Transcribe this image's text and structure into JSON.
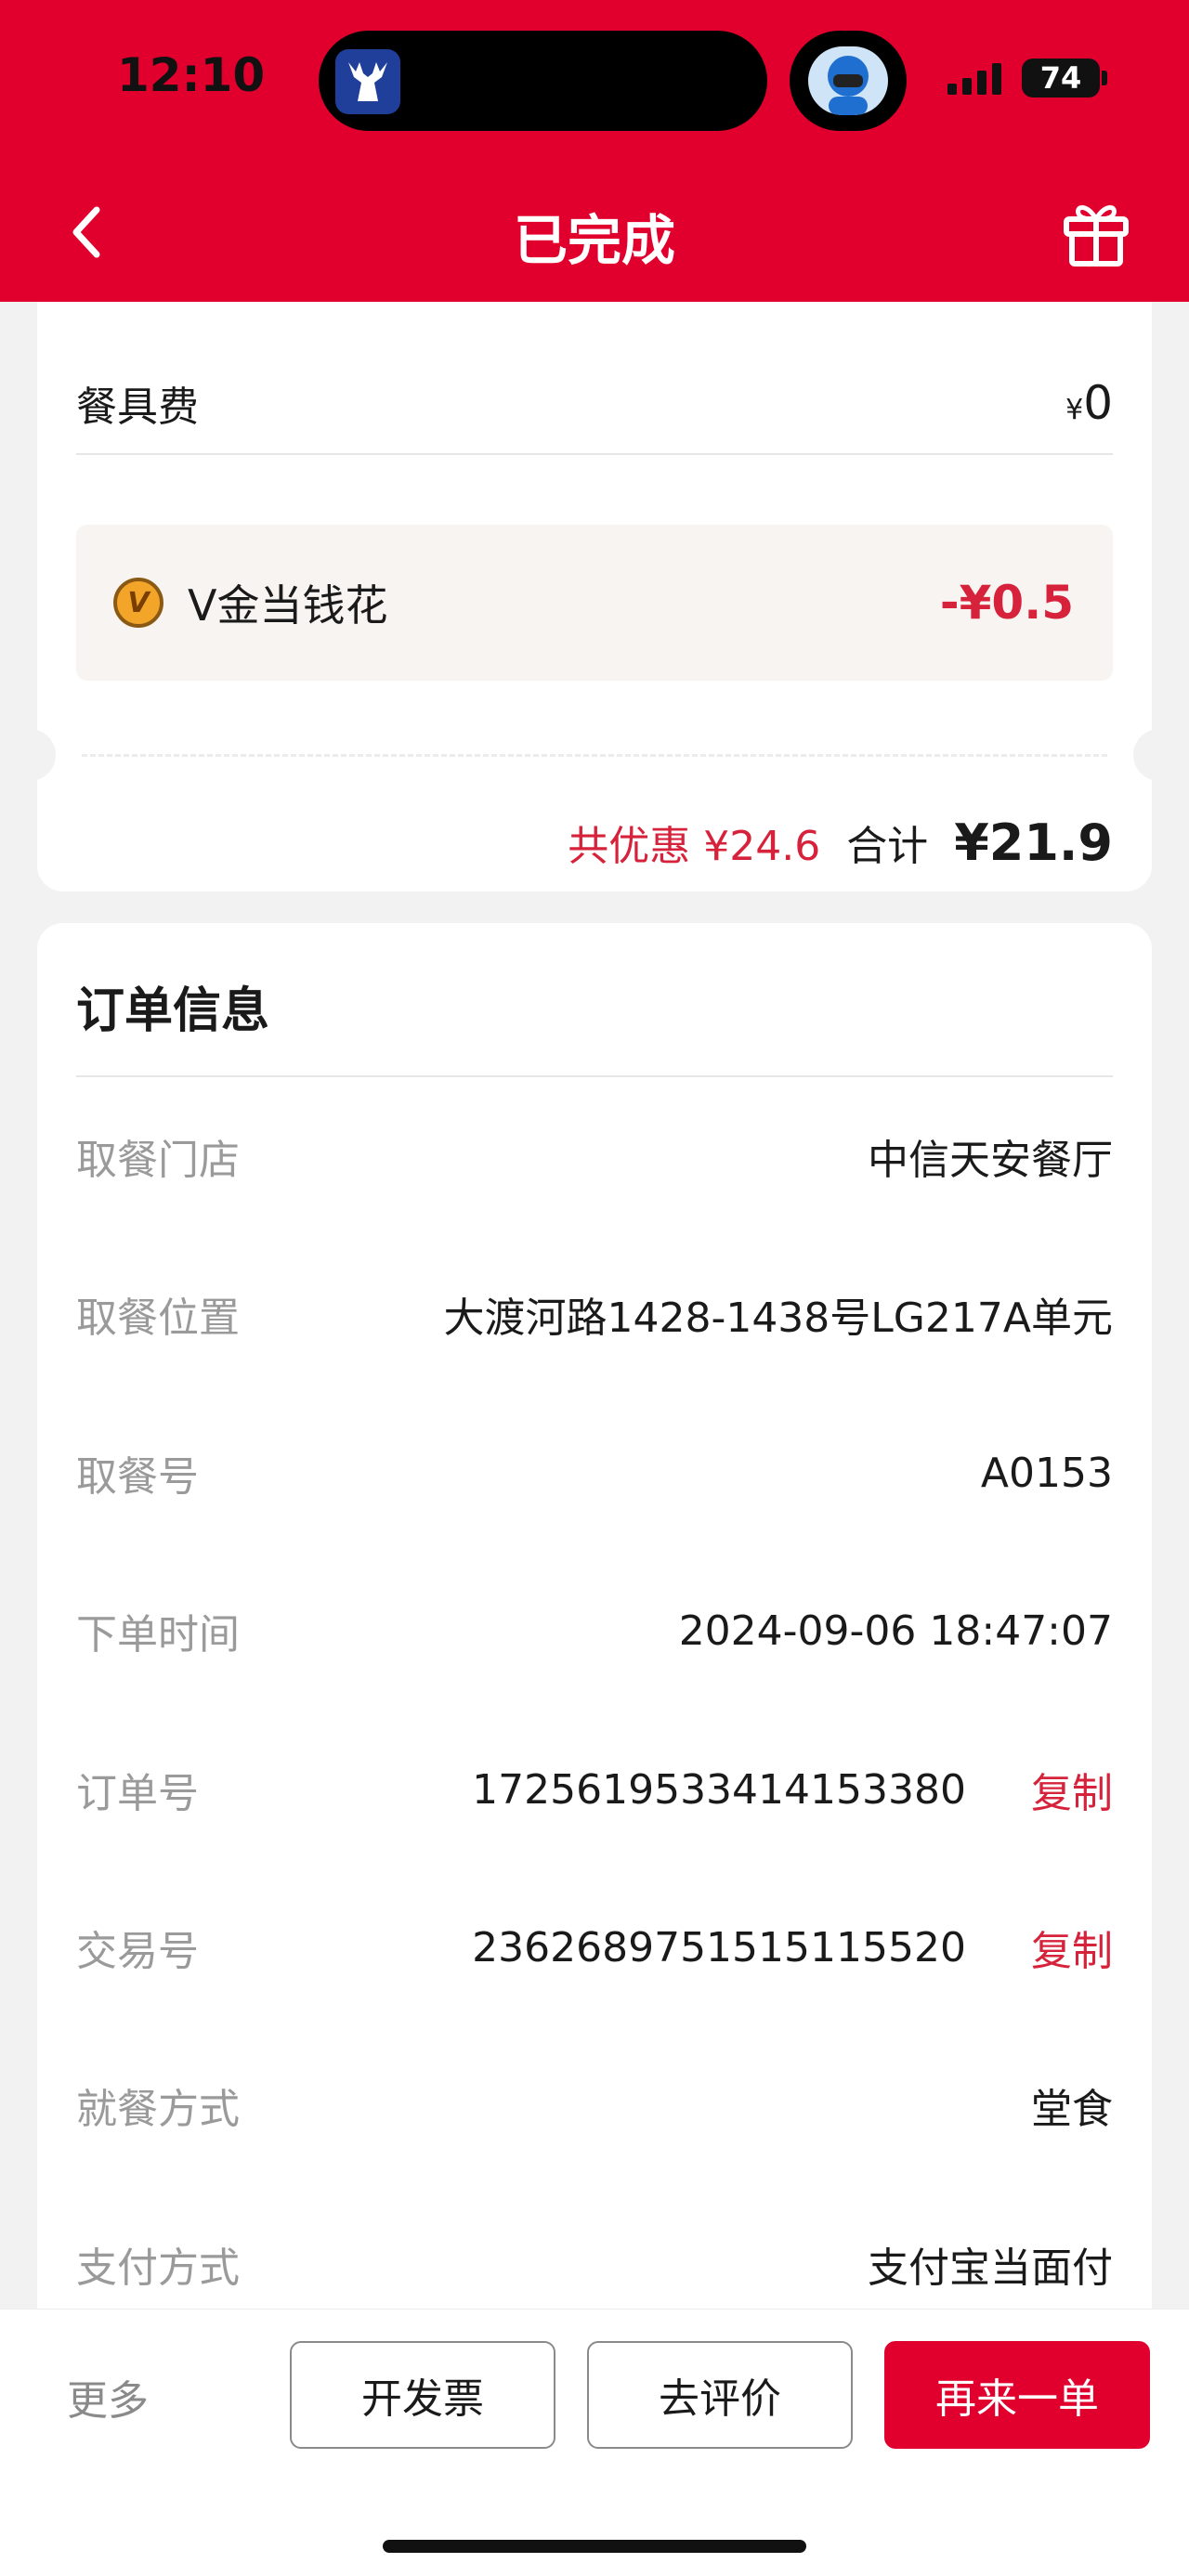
{
  "status_bar": {
    "time": "12:10",
    "battery": "74",
    "icons": [
      "signal-icon",
      "battery-icon"
    ]
  },
  "nav": {
    "title": "已完成",
    "back_icon": "chevron-left-icon",
    "gift_icon": "gift-icon"
  },
  "summary": {
    "tableware_label": "餐具费",
    "tableware_currency": "¥",
    "tableware_value": "0",
    "vgold_icon_text": "V",
    "vgold_label": "V金当钱花",
    "vgold_amount": "-¥0.5",
    "discount_text": "共优惠 ¥24.6",
    "total_label": "合计",
    "total_amount": "¥21.9"
  },
  "order_info": {
    "title": "订单信息",
    "rows": [
      {
        "label": "取餐门店",
        "value": "中信天安餐厅"
      },
      {
        "label": "取餐位置",
        "value": "大渡河路1428-1438号LG217A单元"
      },
      {
        "label": "取餐号",
        "value": "A0153"
      },
      {
        "label": "下单时间",
        "value": "2024-09-06 18:47:07"
      },
      {
        "label": "订单号",
        "value": "1725619533414153380",
        "action": "复制"
      },
      {
        "label": "交易号",
        "value": "2362689751515115520",
        "action": "复制"
      },
      {
        "label": "就餐方式",
        "value": "堂食"
      },
      {
        "label": "支付方式",
        "value": "支付宝当面付"
      }
    ]
  },
  "bottom_bar": {
    "more_label": "更多",
    "invoice_label": "开发票",
    "review_label": "去评价",
    "reorder_label": "再来一单"
  },
  "colors": {
    "brand_red": "#e1002d",
    "accent_red": "#d6223a",
    "muted_gray": "#9a9a9a"
  }
}
